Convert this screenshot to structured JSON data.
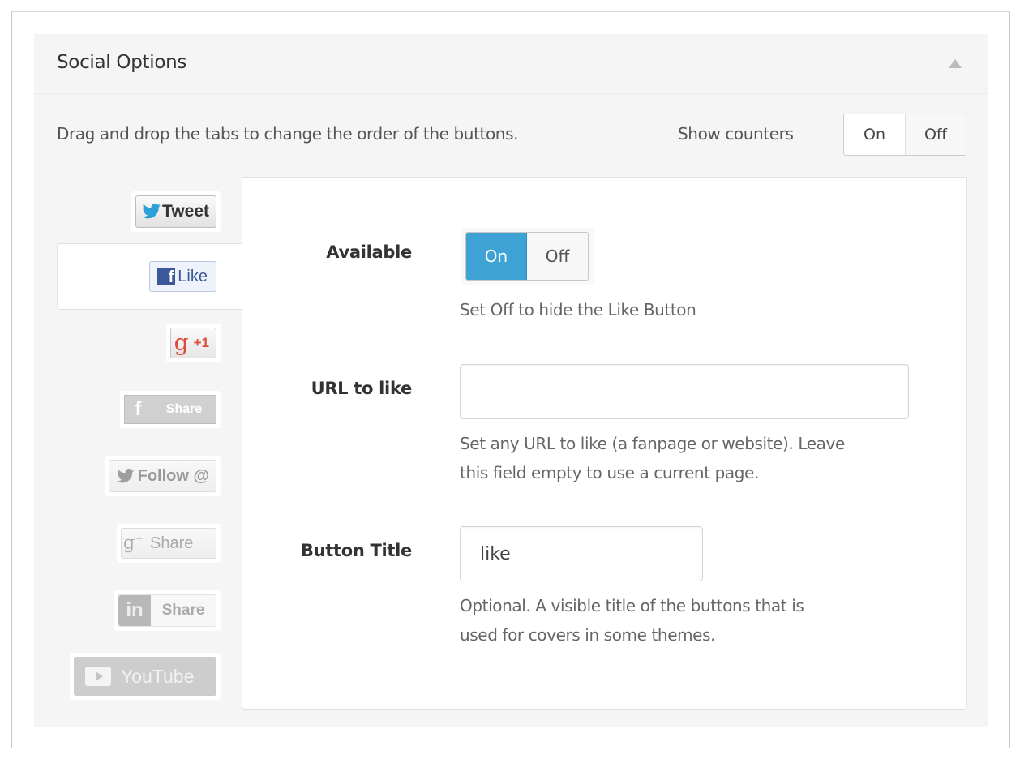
{
  "panel": {
    "title": "Social Options",
    "collapse_icon": "triangle-up-icon",
    "intro": "Drag and drop the tabs to change the order of the buttons.",
    "show_counters": {
      "label": "Show counters",
      "options": [
        "On",
        "Off"
      ],
      "selected": "Off"
    }
  },
  "tabs": [
    {
      "id": "tweet",
      "label": "Tweet",
      "icon": "twitter-bird-icon",
      "active": false,
      "enabled": true
    },
    {
      "id": "like",
      "label": "Like",
      "icon": "facebook-f-icon",
      "active": true,
      "enabled": true
    },
    {
      "id": "plusone",
      "label": "+1",
      "icon": "google-g-icon",
      "active": false,
      "enabled": true
    },
    {
      "id": "fb-share",
      "label": "Share",
      "icon": "facebook-f-icon",
      "active": false,
      "enabled": false
    },
    {
      "id": "follow",
      "label": "Follow @",
      "icon": "twitter-bird-icon",
      "active": false,
      "enabled": false
    },
    {
      "id": "gplus-share",
      "label": "Share",
      "icon": "google-plus-icon",
      "active": false,
      "enabled": false
    },
    {
      "id": "linkedin-share",
      "label": "Share",
      "icon": "linkedin-in-icon",
      "active": false,
      "enabled": false
    },
    {
      "id": "youtube",
      "label": "YouTube",
      "icon": "play-icon",
      "active": false,
      "enabled": false
    }
  ],
  "like_settings": {
    "available": {
      "label": "Available",
      "options": [
        "On",
        "Off"
      ],
      "selected": "On",
      "help": "Set Off to hide the Like Button"
    },
    "url": {
      "label": "URL to like",
      "value": "",
      "placeholder": "",
      "help_line1": "Set any URL to like (a fanpage or website). Leave",
      "help_line2": "this field empty to use a current page."
    },
    "button_title": {
      "label": "Button Title",
      "value": "like",
      "help_line1": "Optional. A visible title of the buttons that is",
      "help_line2": "used for covers in some themes."
    }
  },
  "colors": {
    "accent": "#3ea2d4",
    "twitter": "#2ea0d8",
    "facebook": "#3b5998",
    "google": "#dd4b39",
    "disabled": "#cccccc"
  }
}
